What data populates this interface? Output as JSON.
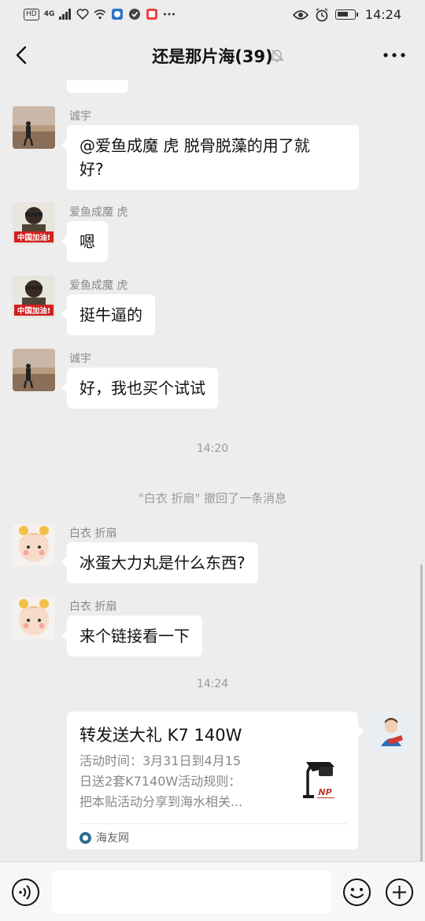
{
  "status_bar": {
    "hd": "HD",
    "network": "4G",
    "time": "14:24",
    "icons": [
      "signal-icon",
      "heart-icon",
      "wifi-icon",
      "app-icon",
      "vpn-icon",
      "notification-icon",
      "more-dots-icon",
      "eye-icon",
      "alarm-icon",
      "battery-icon"
    ]
  },
  "header": {
    "title": "还是那片海(39)",
    "muted": true
  },
  "messages": [
    {
      "sender": "诚宇",
      "text": "@爱鱼成魔 虎  脱骨脱藻的用了就好?",
      "line1": "@爱鱼成魔 虎  脱骨脱藻的用了就",
      "line2": "好?"
    },
    {
      "sender": "爱鱼成魔 虎",
      "text": "嗯",
      "avatar_caption": "中国加油!"
    },
    {
      "sender": "爱鱼成魔 虎",
      "text": "挺牛逼的",
      "avatar_caption": "中国加油!"
    },
    {
      "sender": "诚宇",
      "text": "好，我也买个试试"
    },
    {
      "sender": "白衣 折扇",
      "text": "冰蛋大力丸是什么东西?"
    },
    {
      "sender": "白衣 折扇",
      "text": "来个链接看一下"
    }
  ],
  "time_labels": [
    "14:20",
    "14:24"
  ],
  "system_notice": "\"白衣 折扇\" 撤回了一条消息",
  "link_card": {
    "title": "转发送大礼 K7 140W",
    "desc_lines": [
      "活动时间：3月31日到4月15",
      "日送2套K7140W活动规则：",
      "把本贴活动分享到海水相关..."
    ],
    "thumb_text": "NP",
    "source": "海友网"
  },
  "colors": {
    "background": "#ededed",
    "bubble": "#ffffff",
    "muted_text": "#888888"
  }
}
